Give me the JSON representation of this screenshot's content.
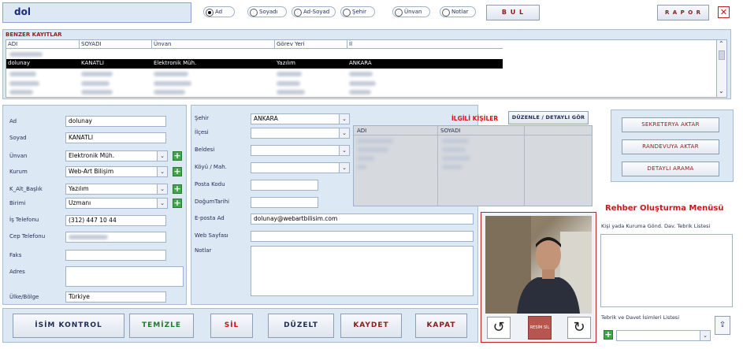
{
  "search": {
    "value": "dol"
  },
  "radios": [
    {
      "label": "Ad",
      "selected": true
    },
    {
      "label": "Soyadı",
      "selected": false
    },
    {
      "label": "Ad-Soyad",
      "selected": false
    },
    {
      "label": "Şehir",
      "selected": false
    },
    {
      "label": "Ünvan",
      "selected": false
    },
    {
      "label": "Notlar",
      "selected": false
    }
  ],
  "top_buttons": {
    "bul": "B U L",
    "rapor": "R A P O R"
  },
  "similar": {
    "title": "BENZER KAYITLAR",
    "headers": [
      "ADI",
      "SOYADI",
      "Ünvan",
      "Görev Yeri",
      "İl"
    ],
    "selected_row": [
      "dolunay",
      "KANATLI",
      "Elektronik Müh.",
      "Yazılım",
      "ANKARA"
    ]
  },
  "form": {
    "labels": {
      "ad": "Ad",
      "soyad": "Soyad",
      "unvan": "Ünvan",
      "kurum": "Kurum",
      "k_alt": "K_Alt_Başlık",
      "birimi": "Birimi",
      "is_tel": "İş Telefonu",
      "cep_tel": "Cep Telefonu",
      "faks": "Faks",
      "adres": "Adres",
      "ulke": "Ülke/Bölge"
    },
    "values": {
      "ad": "dolunay",
      "soyad": "KANATLI",
      "unvan": "Elektronik Müh.",
      "kurum": "Web-Art Bilişim",
      "k_alt": "Yazılım",
      "birimi": "Uzmanı",
      "is_tel": "(312) 447 10 44",
      "ulke": "Türkiye"
    }
  },
  "middle": {
    "labels": {
      "sehir": "Şehir",
      "ilce": "İlçesi",
      "beldesi": "Beldesi",
      "koyu": "Köyü / Mah.",
      "posta": "Posta Kodu",
      "dogum": "DoğumTarihi",
      "eposta": "E-posta Ad",
      "web": "Web Sayfası",
      "notlar": "Notlar"
    },
    "values": {
      "sehir": "ANKARA",
      "eposta": "dolunay@webartbilisim.com"
    }
  },
  "related": {
    "title": "İLGİLİ KİŞİLER",
    "button": "DÜZENLE / DETAYLI GÖR",
    "headers": [
      "ADI",
      "SOYADI"
    ]
  },
  "side_buttons": [
    "SEKRETERYA AKTAR",
    "RANDEVUYA AKTAR",
    "DETAYLI ARAMA"
  ],
  "rehber": {
    "title": "Rehber Oluşturma Menüsü",
    "list1_label": "Kişi yada Kuruma Gönd. Dav.  Tebrik Listesi",
    "list2_label": "Tebrik ve Davet İsimleri Listesi"
  },
  "bottom_buttons": [
    {
      "label": "İSİM KONTROL"
    },
    {
      "label": "TEMİZLE"
    },
    {
      "label": "SİL"
    },
    {
      "label": "DÜZELT"
    },
    {
      "label": "KAYDET"
    },
    {
      "label": "KAPAT"
    }
  ],
  "photo": {
    "no_image_label": "RESİM SİL"
  }
}
